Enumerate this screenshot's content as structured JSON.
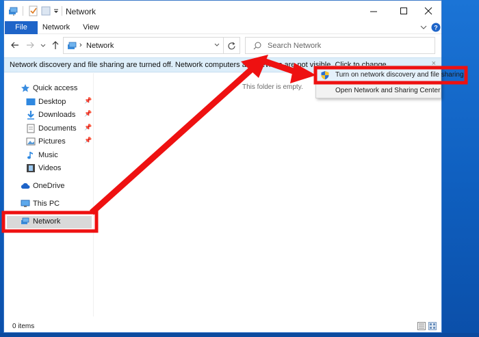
{
  "window": {
    "title": "Network"
  },
  "ribbon": {
    "tabs": [
      "File",
      "Network",
      "View"
    ]
  },
  "navbar": {
    "address": "Network",
    "search_placeholder": "Search Network"
  },
  "infobar": {
    "text": "Network discovery and file sharing are turned off. Network computers and devices are not visible. Click to change...",
    "close_glyph": "×"
  },
  "sidebar": {
    "items": [
      {
        "label": "Quick access",
        "icon": "star-icon",
        "pinned": false
      },
      {
        "label": "Desktop",
        "icon": "desktop-folder-icon",
        "pinned": true
      },
      {
        "label": "Downloads",
        "icon": "download-arrow-icon",
        "pinned": true
      },
      {
        "label": "Documents",
        "icon": "documents-icon",
        "pinned": true
      },
      {
        "label": "Pictures",
        "icon": "pictures-icon",
        "pinned": true
      },
      {
        "label": "Music",
        "icon": "music-note-icon",
        "pinned": false
      },
      {
        "label": "Videos",
        "icon": "film-icon",
        "pinned": false
      },
      {
        "label": "OneDrive",
        "icon": "cloud-icon",
        "pinned": false
      },
      {
        "label": "This PC",
        "icon": "monitor-icon",
        "pinned": false
      },
      {
        "label": "Network",
        "icon": "network-icon",
        "pinned": false,
        "selected": true
      }
    ]
  },
  "content": {
    "empty_text": "This folder is empty."
  },
  "status": {
    "items_text": "0 items"
  },
  "context_menu": {
    "items": [
      {
        "label": "Turn on network discovery and file sharing",
        "icon": "uac-shield-icon",
        "highlighted": true
      },
      {
        "label": "Open Network and Sharing Center",
        "icon": "",
        "highlighted": false
      }
    ]
  },
  "colors": {
    "accent": "#1e64c8",
    "infobar_bg": "#ddeefa",
    "annotation_red": "#ee1111",
    "desktop_blue": "#1b74d6"
  }
}
